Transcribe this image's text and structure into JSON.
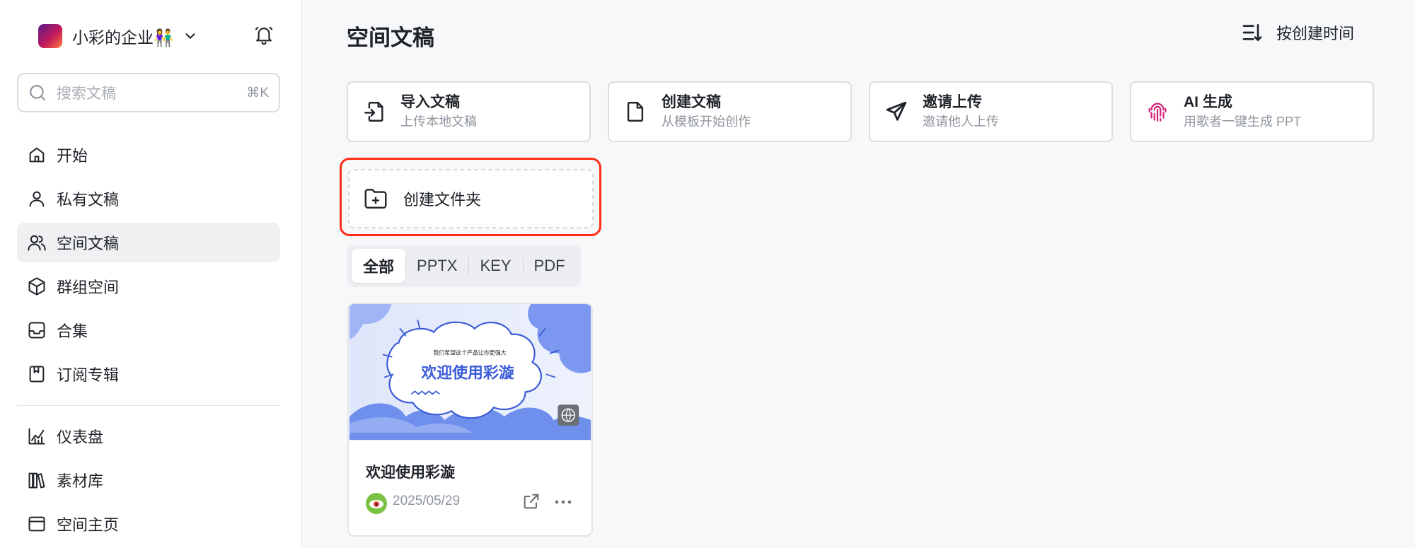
{
  "sidebar": {
    "org_name": "小彩的企业👫",
    "search": {
      "placeholder": "搜索文稿",
      "shortcut": "⌘K"
    },
    "nav": [
      {
        "label": "开始",
        "icon": "home-icon"
      },
      {
        "label": "私有文稿",
        "icon": "user-icon"
      },
      {
        "label": "空间文稿",
        "icon": "users-icon",
        "active": true
      },
      {
        "label": "群组空间",
        "icon": "cube-icon"
      },
      {
        "label": "合集",
        "icon": "inbox-icon"
      },
      {
        "label": "订阅专辑",
        "icon": "bookmark-icon"
      },
      {
        "label": "仪表盘",
        "icon": "chart-icon"
      },
      {
        "label": "素材库",
        "icon": "library-icon"
      },
      {
        "label": "空间主页",
        "icon": "browser-icon"
      }
    ]
  },
  "main": {
    "title": "空间文稿",
    "sort_label": "按创建时间",
    "actions": [
      {
        "title": "导入文稿",
        "subtitle": "上传本地文稿",
        "icon": "import-file-icon"
      },
      {
        "title": "创建文稿",
        "subtitle": "从模板开始创作",
        "icon": "file-icon"
      },
      {
        "title": "邀请上传",
        "subtitle": "邀请他人上传",
        "icon": "send-icon"
      },
      {
        "title": "AI 生成",
        "subtitle": "用歌者一键生成 PPT",
        "icon": "ai-fingerprint-icon"
      }
    ],
    "create_folder_label": "创建文件夹",
    "filters": [
      "全部",
      "PPTX",
      "KEY",
      "PDF"
    ],
    "active_filter": "全部",
    "card": {
      "title": "欢迎使用彩漩",
      "date": "2025/05/29",
      "thumb_caption": "我们希望这个产品让你更强大",
      "thumb_title": "欢迎使用彩漩"
    }
  },
  "colors": {
    "accent_red": "#ff2d1a",
    "active_bg": "#eff0f2",
    "thumb_blue": "#3a5bd9"
  }
}
